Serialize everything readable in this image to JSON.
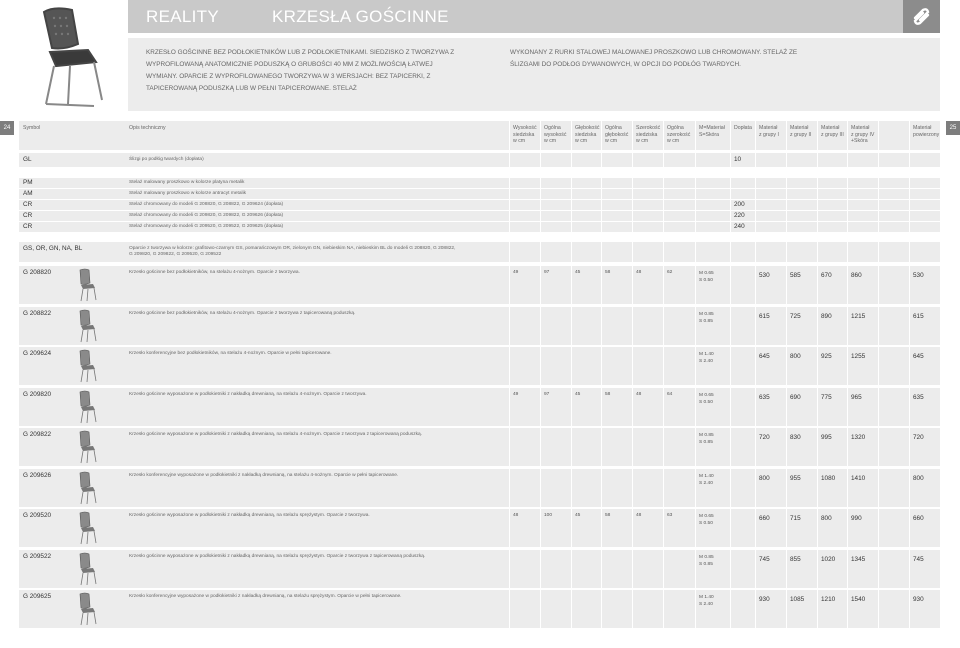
{
  "header": {
    "brand": "REALITY",
    "category": "KRZESŁA GOŚCINNE"
  },
  "description": {
    "left": "KRZESŁO GOŚCINNE BEZ PODŁOKIETNIKÓW LUB Z PODŁOKIETNIKAMI. SIEDZISKO Z TWORZYWA Z WYPROFILOWANĄ ANATOMICZNIE PODUSZKĄ O GRUBOŚCI 40 MM Z MOŻLIWOŚCIĄ ŁATWEJ WYMIANY. OPARCIE Z WYPROFILOWANEGO TWORZYWA W 3 WERSJACH: BEZ TAPICERKI, Z TAPICEROWANĄ PODUSZKĄ LUB W PEŁNI TAPICEROWANE. STELAŻ",
    "right": "WYKONANY Z RURKI STALOWEJ MALOWANEJ PROSZKOWO LUB CHROMOWANY. STELAŻ ZE ŚLIZGAMI DO PODŁOG DYWANOWYCH, W OPCJI DO PODŁÓG TWARDYCH."
  },
  "pages": {
    "left": "24",
    "right": "25"
  },
  "columns": {
    "symbol": "Symbol",
    "opis": "Opis techniczny",
    "wys_siedziska": [
      "Wysokość",
      "siedziska",
      "w cm"
    ],
    "ogolna_wys": [
      "Ogólna",
      "wysokość",
      "w cm"
    ],
    "glebokosc_siedziska": [
      "Głębokość",
      "siedziska",
      "w cm"
    ],
    "ogolna_glebokosc": [
      "Ogólna",
      "głębokość",
      "w cm"
    ],
    "szerokosc_siedziska": [
      "Szerokość",
      "siedziska",
      "w cm"
    ],
    "ogolna_szerokosc": [
      "Ogólna",
      "szerokość",
      "w cm"
    ],
    "material": [
      "M=Materiał",
      "S=Skóra"
    ],
    "doplata": [
      "Dopłata"
    ],
    "grupa1": [
      "Materiał",
      "z grupy I"
    ],
    "grupa2": [
      "Materiał",
      "z grupy II"
    ],
    "grupa3": [
      "Materiał",
      "z grupy III"
    ],
    "grupa4": [
      "Materiał",
      "z grupy IV",
      "+Skóra"
    ],
    "powierzony": [
      "Materiał",
      "powierzony"
    ]
  },
  "options": [
    {
      "symbol": "GL",
      "desc": "Ślizgi po podłóg twardych (dopłata)",
      "doplata": "10"
    },
    {
      "symbol": "PM",
      "desc": "Stelaż malowany proszkowo w kolorze platyna metalik",
      "doplata": ""
    },
    {
      "symbol": "AM",
      "desc": "Stelaż malowany proszkowo w kolorze antracyt metalik",
      "doplata": ""
    },
    {
      "symbol": "CR",
      "desc": "Stelaż chromowany do modeli G 208820, G 208822, G 209624 (dopłata)",
      "doplata": "200"
    },
    {
      "symbol": "CR",
      "desc": "Stelaż chromowany do modeli G 209820, G 209822, G 209626 (dopłata)",
      "doplata": "220"
    },
    {
      "symbol": "CR",
      "desc": "Stelaż chromowany do modeli G 209520, G 209522, G 209625 (dopłata)",
      "doplata": "240"
    },
    {
      "symbol": "GS, OR, GN, NA, BL",
      "desc": "Oparcie z tworzywa w kolorze: grafitowo-czarnym GS, pomarańczowym OR, zielonym GN, niebieskim NA, niebieskim BL do modeli G 208820, G 208822, G 209820, G 209822, G 209520, G 209522",
      "doplata": ""
    }
  ],
  "products": [
    {
      "symbol": "G 208820",
      "desc": "Krzesło gościnne bez podłokietników, na stelażu 4-nożnym. Oparcie z tworzywa.",
      "dims": [
        "49",
        "97",
        "45",
        "58",
        "48",
        "62"
      ],
      "mat": [
        "M 0.65",
        "S 0.50"
      ],
      "prices": [
        "530",
        "585",
        "670",
        "860",
        "530"
      ]
    },
    {
      "symbol": "G 208822",
      "desc": "Krzesło gościnne bez podłokietników, na stelażu 4-nożnym. Oparcie z tworzywa z tapicerowaną poduszką.",
      "dims": [
        "",
        "",
        "",
        "",
        "",
        ""
      ],
      "mat": [
        "M 0.85",
        "S 0.85"
      ],
      "prices": [
        "615",
        "725",
        "890",
        "1215",
        "615"
      ]
    },
    {
      "symbol": "G 209624",
      "desc": "Krzesło konferencyjne bez podłokietników, na stelażu 4-nożnym. Oparcie w pełni tapicerowane.",
      "dims": [
        "",
        "",
        "",
        "",
        "",
        ""
      ],
      "mat": [
        "M 1.40",
        "S 2.40"
      ],
      "prices": [
        "645",
        "800",
        "925",
        "1255",
        "645"
      ]
    },
    {
      "symbol": "G 209820",
      "desc": "Krzesło gościnne wyposażone w podłokietniki z nakładką drewnianą, na stelażu 4-nożnym. Oparcie z tworzywa.",
      "dims": [
        "49",
        "97",
        "45",
        "58",
        "48",
        "64"
      ],
      "mat": [
        "M 0.65",
        "S 0.50"
      ],
      "prices": [
        "635",
        "690",
        "775",
        "965",
        "635"
      ]
    },
    {
      "symbol": "G 209822",
      "desc": "Krzesło gościnne wyposażone w podłokietniki z nakładką drewnianą, na stelażu 4-nożnym. Oparcie z tworzywa z tapicerowaną poduszką.",
      "dims": [
        "",
        "",
        "",
        "",
        "",
        ""
      ],
      "mat": [
        "M 0.85",
        "S 0.85"
      ],
      "prices": [
        "720",
        "830",
        "995",
        "1320",
        "720"
      ]
    },
    {
      "symbol": "G 209626",
      "desc": "Krzesło konferencyjne wyposażone w podłokietniki z nakładką drewnianą, na stelażu 4-nożnym. Oparcie w pełni tapicerowane.",
      "dims": [
        "",
        "",
        "",
        "",
        "",
        ""
      ],
      "mat": [
        "M 1.40",
        "S 2.40"
      ],
      "prices": [
        "800",
        "955",
        "1080",
        "1410",
        "800"
      ]
    },
    {
      "symbol": "G 209520",
      "desc": "Krzesło gościnne wyposażone w podłokietniki z nakładką drewnianą, na stelażu sprężystym. Oparcie z tworzywa.",
      "dims": [
        "48",
        "100",
        "45",
        "58",
        "48",
        "63"
      ],
      "mat": [
        "M 0.65",
        "S 0.50"
      ],
      "prices": [
        "660",
        "715",
        "800",
        "990",
        "660"
      ]
    },
    {
      "symbol": "G 209522",
      "desc": "Krzesło gościnne wyposażone w podłokietniki z nakładką drewnianą, na stelażu sprężystym. Oparcie z tworzywa z tapicerowaną poduszką.",
      "dims": [
        "",
        "",
        "",
        "",
        "",
        ""
      ],
      "mat": [
        "M 0.85",
        "S 0.85"
      ],
      "prices": [
        "745",
        "855",
        "1020",
        "1345",
        "745"
      ]
    },
    {
      "symbol": "G 209625",
      "desc": "Krzesło konferencyjne wyposażone w podłokietniki z nakładką drewnianą, na stelażu sprężystym. Oparcie w pełni tapicerowane.",
      "dims": [
        "",
        "",
        "",
        "",
        "",
        ""
      ],
      "mat": [
        "M 1.40",
        "S 2.40"
      ],
      "prices": [
        "930",
        "1085",
        "1210",
        "1540",
        "930"
      ]
    }
  ],
  "colors": {
    "header_bg": "#c9c9c9",
    "row_bg": "#ececec",
    "logo_bg": "#8c8c8c"
  }
}
